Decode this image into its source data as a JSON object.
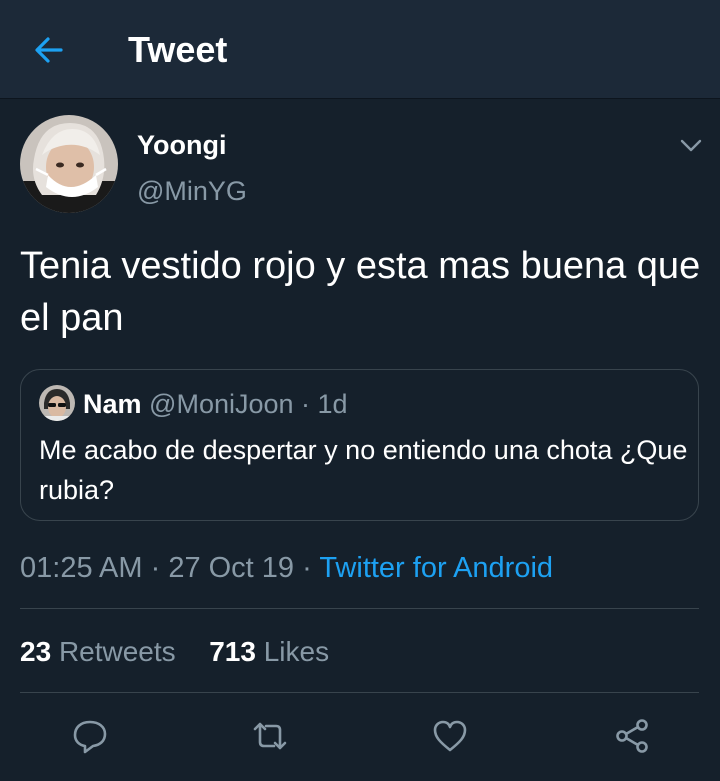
{
  "header": {
    "title": "Tweet",
    "back_icon": "arrow-left-icon"
  },
  "tweet": {
    "author": {
      "name": "Yoongi",
      "handle": "@MinYG"
    },
    "text": "Tenia vestido rojo y esta mas buena que el pan",
    "quoted": {
      "name": "Nam",
      "handle": "@MoniJoon",
      "sep": " · ",
      "age": "1d",
      "text": "Me acabo de despertar y no entiendo una chota ¿Que rubia?"
    },
    "time": "01:25 AM",
    "date": "27 Oct 19",
    "sep": " · ",
    "source": "Twitter for Android",
    "stats": {
      "retweets_count": "23",
      "retweets_label": "Retweets",
      "likes_count": "713",
      "likes_label": "Likes"
    }
  },
  "actions": [
    "reply-icon",
    "retweet-icon",
    "like-icon",
    "share-icon"
  ],
  "colors": {
    "background": "#15202b",
    "header": "#1c2938",
    "accent": "#1da1f2",
    "muted": "#8899a6",
    "border": "#38444d"
  }
}
